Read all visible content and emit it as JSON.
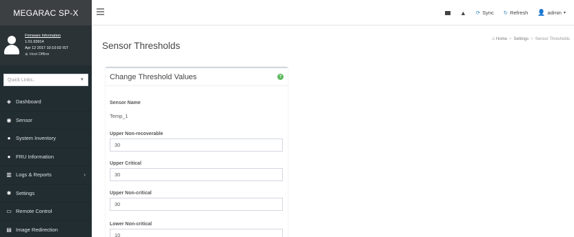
{
  "sidebar": {
    "brand": "MEGARAC SP-X",
    "user_panel": {
      "firmware_link": "Firmware Information",
      "version": "1.01.93914",
      "date": "Apr 12 2017 10:10:02 IST",
      "host_status": "Host Offline"
    },
    "quick_links": {
      "placeholder": "Quick Links.."
    },
    "menu": [
      {
        "label": "Dashboard",
        "icon": "dashboard-icon"
      },
      {
        "label": "Sensor",
        "icon": "sensor-icon"
      },
      {
        "label": "System Inventory",
        "icon": "info-icon"
      },
      {
        "label": "FRU Information",
        "icon": "info-icon"
      },
      {
        "label": "Logs & Reports",
        "icon": "chart-icon"
      },
      {
        "label": "Settings",
        "icon": "gear-icon"
      },
      {
        "label": "Remote Control",
        "icon": "monitor-icon"
      },
      {
        "label": "Image Redirection",
        "icon": "disk-icon"
      }
    ]
  },
  "topbar": {
    "sync_label": "Sync",
    "refresh_label": "Refresh",
    "user_label": "admin"
  },
  "content": {
    "page_title": "Sensor Thresholds",
    "breadcrumb": {
      "home": "Home",
      "settings": "Settings",
      "current": "Sensor Thresholds"
    },
    "box": {
      "title": "Change Threshold Values",
      "sensor_name_label": "Sensor Name",
      "sensor_name_value": "Temp_1",
      "fields": [
        {
          "label": "Upper Non-recoverable",
          "value": "30"
        },
        {
          "label": "Upper Critical",
          "value": "30"
        },
        {
          "label": "Upper Non-critical",
          "value": "30"
        },
        {
          "label": "Lower Non-critical",
          "value": "10"
        }
      ]
    }
  },
  "colors": {
    "sidebar_bg": "#222d32",
    "accent": "#3c8dbc",
    "help_green": "#5cb85c"
  }
}
